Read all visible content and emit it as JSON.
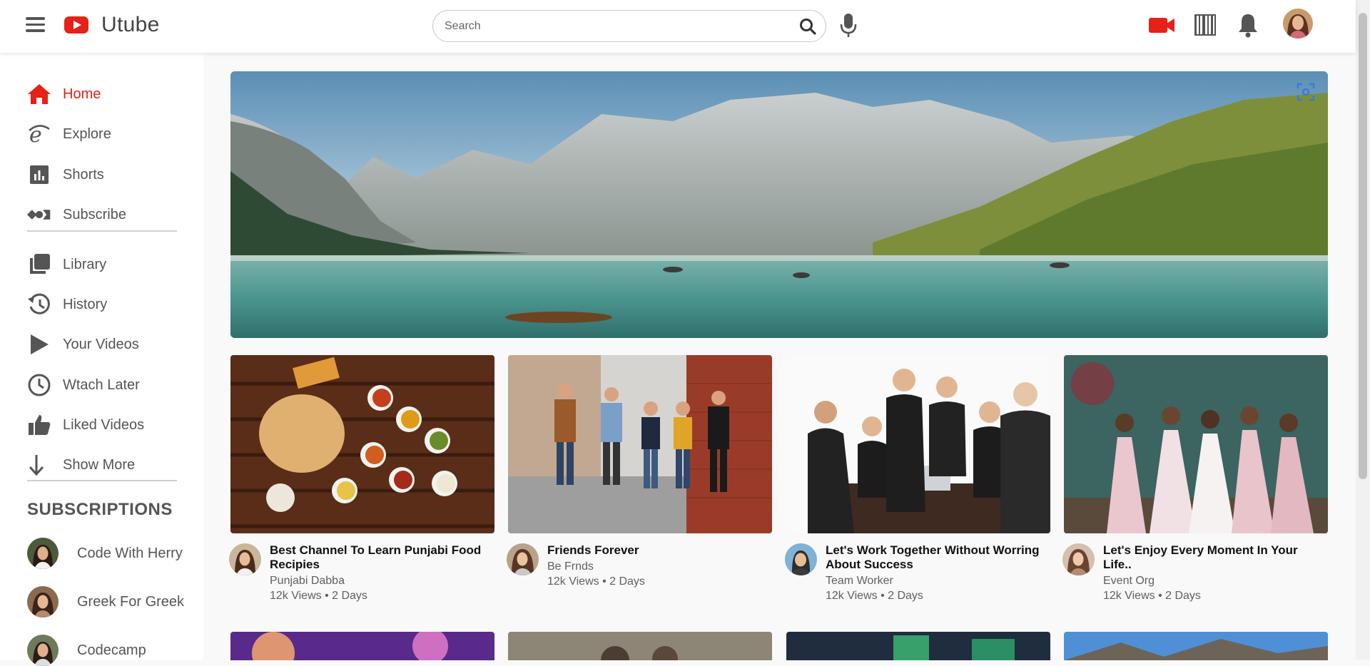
{
  "app": {
    "name": "Utube"
  },
  "search": {
    "placeholder": "Search"
  },
  "colors": {
    "brand": "#e62117",
    "sidebar_text": "#555555",
    "meta_text": "#606060"
  },
  "icons": {
    "menu": "hamburger-menu-icon",
    "logo": "youtube-play-icon",
    "search": "search-icon",
    "mic": "microphone-icon",
    "create": "video-camera-icon",
    "apps": "barcode-icon",
    "notifications": "bell-icon",
    "banner_action": "scan-icon"
  },
  "sidebar": {
    "items": [
      {
        "label": "Home",
        "icon": "home-icon",
        "active": true
      },
      {
        "label": "Explore",
        "icon": "explorer-icon"
      },
      {
        "label": "Shorts",
        "icon": "bar-chart-icon"
      },
      {
        "label": "Subscribe",
        "icon": "subscribe-icon"
      },
      {
        "label": "Library",
        "icon": "library-icon"
      },
      {
        "label": "History",
        "icon": "history-icon"
      },
      {
        "label": "Your Videos",
        "icon": "play-icon"
      },
      {
        "label": "Wtach Later",
        "icon": "clock-icon"
      },
      {
        "label": "Liked Videos",
        "icon": "thumbs-up-icon"
      },
      {
        "label": "Show More",
        "icon": "arrow-down-icon"
      }
    ],
    "subscriptions_title": "SUBSCRIPTIONS",
    "subscriptions": [
      {
        "label": "Code With Herry"
      },
      {
        "label": "Greek For Greek"
      },
      {
        "label": "Codecamp"
      }
    ]
  },
  "videos": [
    {
      "title": "Best Channel To Learn Punjabi Food Recipies",
      "channel": "Punjabi Dabba",
      "stats": "12k Views • 2 Days"
    },
    {
      "title": "Friends Forever",
      "channel": "Be Frnds",
      "stats": "12k Views • 2 Days"
    },
    {
      "title": "Let's Work Together Without Worring About Success",
      "channel": "Team Worker",
      "stats": "12k Views • 2 Days"
    },
    {
      "title": "Let's Enjoy Every Moment In Your Life..",
      "channel": "Event Org",
      "stats": "12k Views • 2 Days"
    }
  ]
}
